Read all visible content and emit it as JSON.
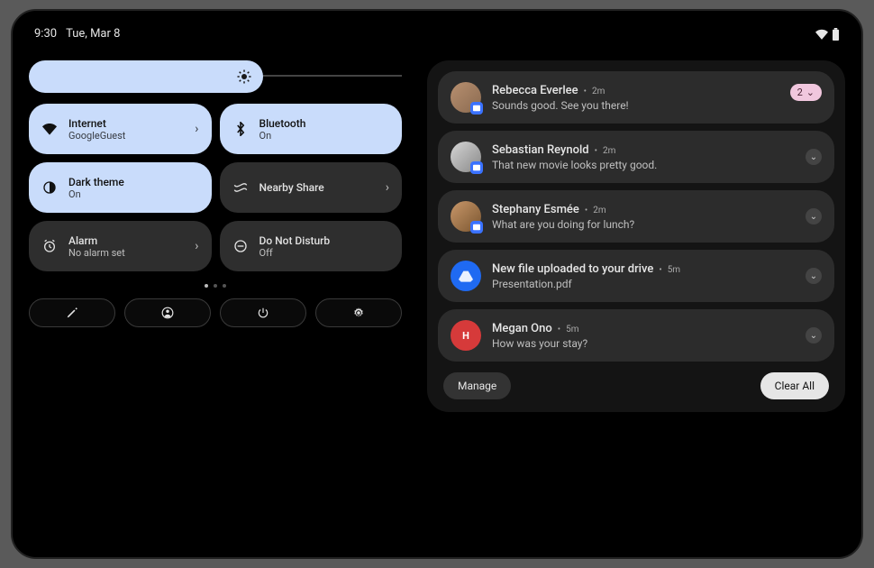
{
  "statusbar": {
    "time": "9:30",
    "date": "Tue, Mar 8"
  },
  "brightness": {
    "level_pct": 56
  },
  "quick_settings": {
    "tiles": [
      {
        "id": "wifi",
        "title": "Internet",
        "subtitle": "GoogleGuest",
        "state": "on",
        "chevron": true
      },
      {
        "id": "bluetooth",
        "title": "Bluetooth",
        "subtitle": "On",
        "state": "on",
        "chevron": false
      },
      {
        "id": "dark-theme",
        "title": "Dark theme",
        "subtitle": "On",
        "state": "on",
        "chevron": false
      },
      {
        "id": "nearby-share",
        "title": "Nearby Share",
        "subtitle": "",
        "state": "off",
        "chevron": true
      },
      {
        "id": "alarm",
        "title": "Alarm",
        "subtitle": "No alarm set",
        "state": "off",
        "chevron": true
      },
      {
        "id": "dnd",
        "title": "Do Not Disturb",
        "subtitle": "Off",
        "state": "off",
        "chevron": false
      }
    ],
    "page": {
      "current": 1,
      "total": 3
    }
  },
  "notifications": {
    "items": [
      {
        "name": "Rebecca Everlee",
        "time": "2m",
        "message": "Sounds good. See you there!",
        "group_count": "2",
        "avatar": "person"
      },
      {
        "name": "Sebastian Reynold",
        "time": "2m",
        "message": "That new movie looks pretty good.",
        "avatar": "person"
      },
      {
        "name": "Stephany Esmée",
        "time": "2m",
        "message": "What are you doing for lunch?",
        "avatar": "person"
      },
      {
        "name": "New file uploaded to your drive",
        "time": "5m",
        "message": "Presentation.pdf",
        "avatar": "drive"
      },
      {
        "name": "Megan Ono",
        "time": "5m",
        "message": "How was your stay?",
        "avatar": "hotel"
      }
    ],
    "manage_label": "Manage",
    "clear_label": "Clear All"
  }
}
